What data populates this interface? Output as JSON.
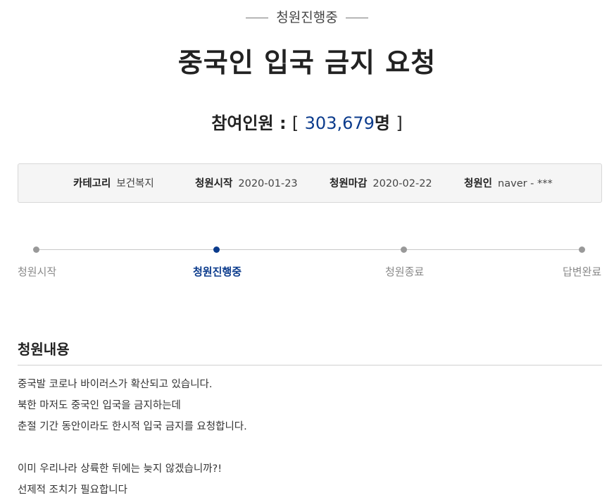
{
  "header": {
    "status": "청원진행중",
    "title": "중국인 입국 금지 요청"
  },
  "participants": {
    "label": "참여인원",
    "colon": ":",
    "open_bracket": "[",
    "number": "303,679",
    "unit": "명",
    "close_bracket": "]"
  },
  "info": {
    "category_label": "카테고리",
    "category_value": "보건복지",
    "start_label": "청원시작",
    "start_value": "2020-01-23",
    "end_label": "청원마감",
    "end_value": "2020-02-22",
    "petitioner_label": "청원인",
    "petitioner_value": "naver - ***"
  },
  "progress": {
    "steps": [
      {
        "label": "청원시작",
        "active": false
      },
      {
        "label": "청원진행중",
        "active": true
      },
      {
        "label": "청원종료",
        "active": false
      },
      {
        "label": "답변완료",
        "active": false
      }
    ]
  },
  "content": {
    "section_title": "청원내용",
    "lines": [
      "중국발 코로나 바이러스가 확산되고 있습니다.",
      "북한 마저도 중국인 입국을 금지하는데",
      "춘절 기간 동안이라도 한시적 입국 금지를 요청합니다.",
      "",
      "이미 우리나라 상륙한 뒤에는 늦지 않겠습니까?!",
      "선제적 조치가 필요합니다"
    ]
  },
  "colors": {
    "accent": "#0b3b8c",
    "inactive": "#999999",
    "info_bg": "#f5f5f5"
  }
}
